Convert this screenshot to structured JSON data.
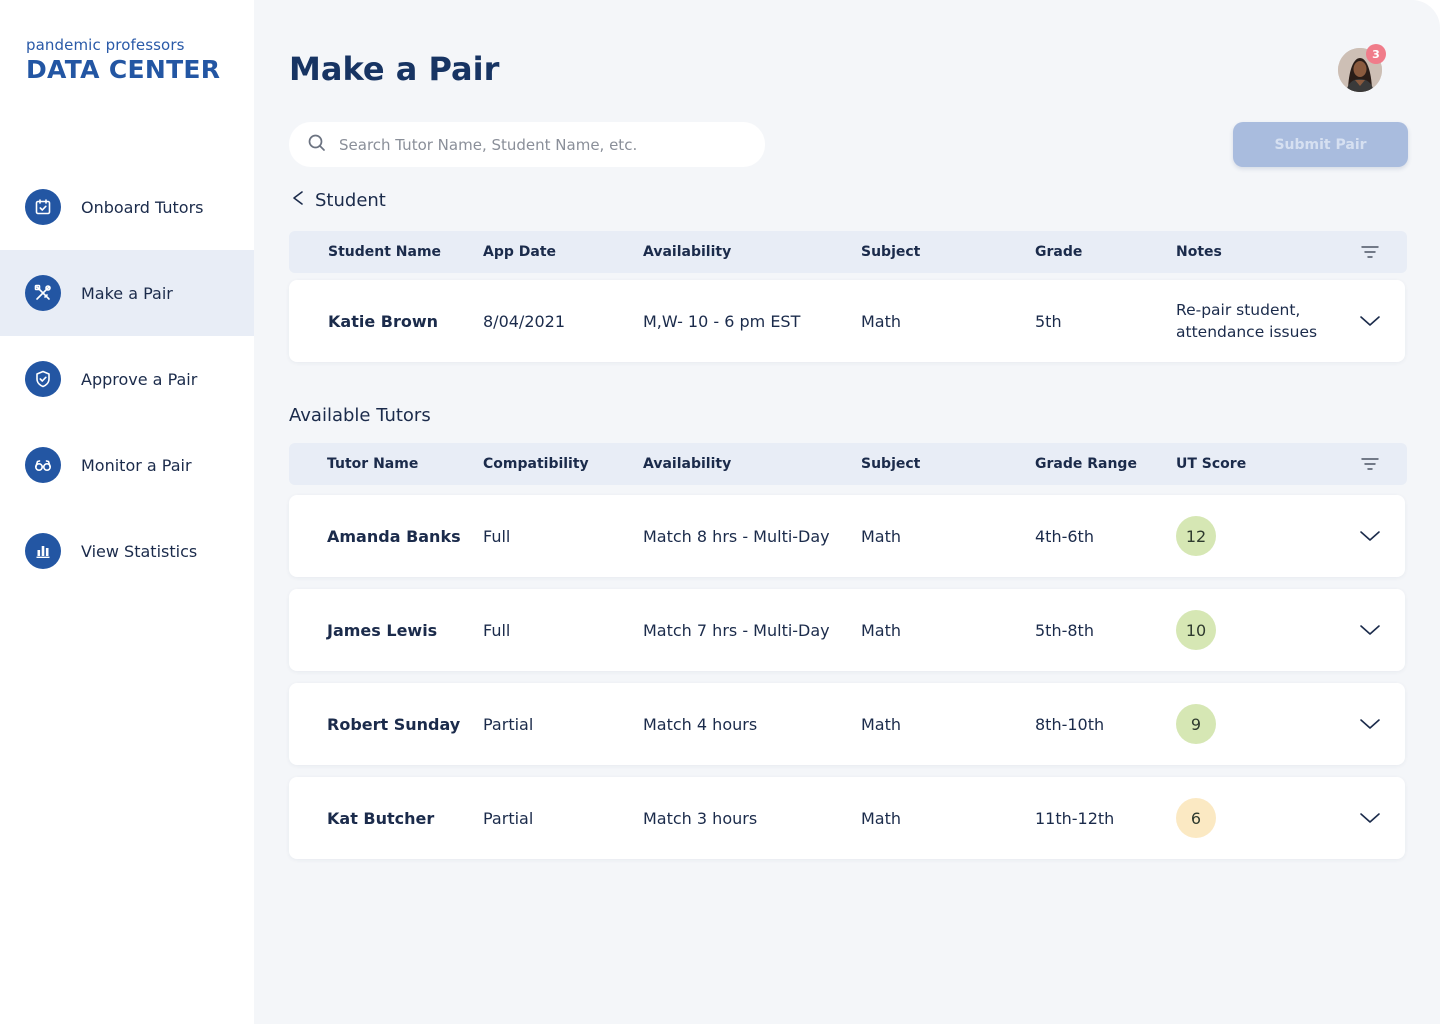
{
  "brand": {
    "sub": "pandemic professors",
    "main": "DATA CENTER"
  },
  "nav": [
    {
      "label": "Onboard Tutors",
      "icon": "calendar-check-icon",
      "active": false
    },
    {
      "label": "Make a Pair",
      "icon": "tools-icon",
      "active": true
    },
    {
      "label": "Approve a Pair",
      "icon": "shield-check-icon",
      "active": false
    },
    {
      "label": "Monitor a Pair",
      "icon": "glasses-icon",
      "active": false
    },
    {
      "label": "View Statistics",
      "icon": "bar-chart-icon",
      "active": false
    }
  ],
  "page": {
    "title": "Make a Pair"
  },
  "user": {
    "notification_count": "3"
  },
  "search": {
    "placeholder": "Search Tutor Name, Student Name, etc."
  },
  "submit": {
    "label": "Submit Pair"
  },
  "student_section": {
    "back_label": "Student",
    "columns": [
      "Student Name",
      "App Date",
      "Availability",
      "Subject",
      "Grade",
      "Notes"
    ],
    "row": {
      "name": "Katie Brown",
      "app_date": "8/04/2021",
      "availability": "M,W- 10 - 6 pm EST",
      "subject": "Math",
      "grade": "5th",
      "notes": "Re-pair student, attendance issues"
    }
  },
  "tutors_section": {
    "title": "Available Tutors",
    "columns": [
      "Tutor Name",
      "Compatibility",
      "Availability",
      "Subject",
      "Grade Range",
      "UT Score"
    ],
    "rows": [
      {
        "name": "Amanda Banks",
        "compatibility": "Full",
        "availability": "Match 8 hrs - Multi-Day",
        "subject": "Math",
        "grade_range": "4th-6th",
        "score": "12",
        "score_color": "#d6e7b4"
      },
      {
        "name": "James Lewis",
        "compatibility": "Full",
        "availability": "Match 7 hrs - Multi-Day",
        "subject": "Math",
        "grade_range": "5th-8th",
        "score": "10",
        "score_color": "#d6e7b4"
      },
      {
        "name": "Robert Sunday",
        "compatibility": "Partial",
        "availability": "Match 4 hours",
        "subject": "Math",
        "grade_range": "8th-10th",
        "score": "9",
        "score_color": "#d6e7b4"
      },
      {
        "name": "Kat Butcher",
        "compatibility": "Partial",
        "availability": "Match 3 hours",
        "subject": "Math",
        "grade_range": "11th-12th",
        "score": "6",
        "score_color": "#fbe9c3"
      }
    ]
  },
  "colors": {
    "brand": "#2356a3",
    "title": "#173463",
    "header_bg": "#e8edf6",
    "page_bg": "#f4f6f9"
  }
}
